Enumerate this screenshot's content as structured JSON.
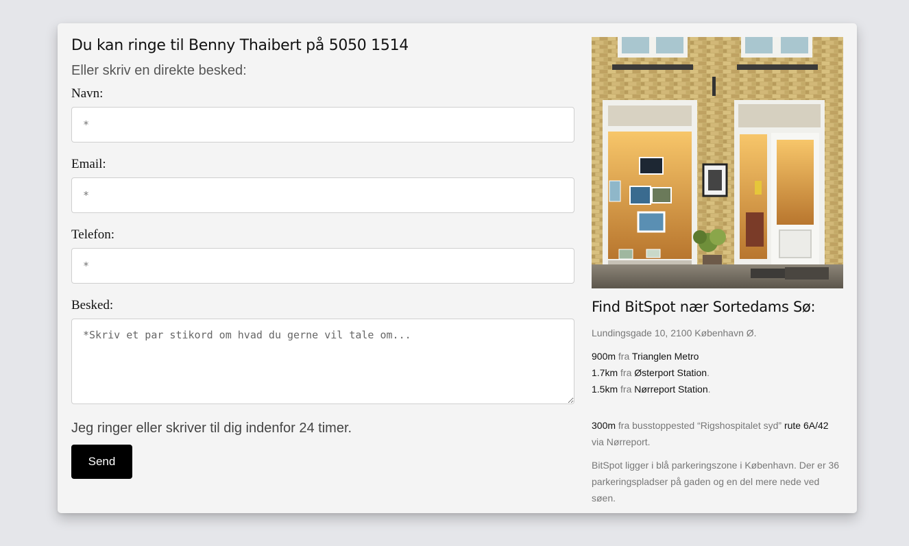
{
  "form": {
    "heading": "Du kan ringe til Benny Thaibert på 5050 1514",
    "subheading": "Eller skriv en direkte besked:",
    "fields": [
      {
        "label": "Navn:",
        "placeholder": "*"
      },
      {
        "label": "Email:",
        "placeholder": "*"
      },
      {
        "label": "Telefon:",
        "placeholder": "*"
      }
    ],
    "message": {
      "label": "Besked:",
      "placeholder": "*Skriv et par stikord om hvad du gerne vil tale om..."
    },
    "note": "Jeg ringer eller skriver til dig indenfor 24 timer.",
    "send_label": "Send"
  },
  "location": {
    "image_alt": "BitSpot butiksfacade",
    "title": "Find BitSpot nær Sortedams Sø:",
    "address": "Lundingsgade 10, 2100 København Ø.",
    "distances": [
      {
        "distance": "900m",
        "word": "fra",
        "place": "Trianglen Metro",
        "suffix": ""
      },
      {
        "distance": "1.7km",
        "word": "fra",
        "place": "Østerport Station",
        "suffix": "."
      },
      {
        "distance": "1.5km",
        "word": "fra",
        "place": "Nørreport Station",
        "suffix": "."
      }
    ],
    "bus": {
      "distance": "300m",
      "text": "fra busstoppested “Rigshospitalet syd”",
      "route_word": "rute",
      "route": "6A/42",
      "via": "via Nørreport."
    },
    "parking": "BitSpot ligger i blå parkeringszone i København. Der er 36 parkeringspladser på gaden og en del mere nede ved søen."
  },
  "colors": {
    "page_bg": "#e5e6ea",
    "card_bg": "#f4f4f4",
    "button_bg": "#000000",
    "button_text": "#ffffff"
  }
}
